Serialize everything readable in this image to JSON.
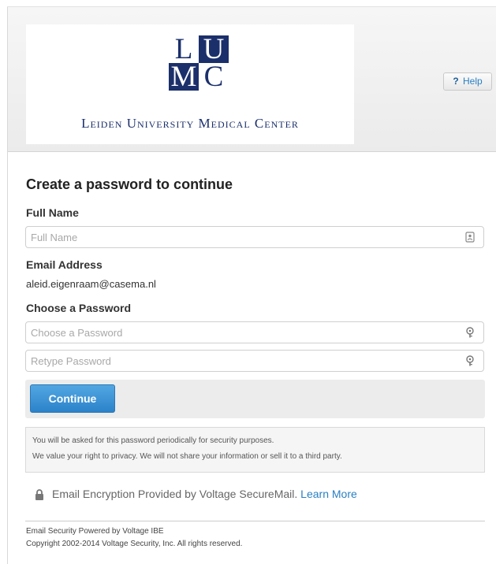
{
  "header": {
    "logo": {
      "letters": [
        "L",
        "U",
        "M",
        "C"
      ],
      "name": "Leiden University Medical Center"
    },
    "help": {
      "icon": "?",
      "label": "Help"
    }
  },
  "form": {
    "title": "Create a password to continue",
    "full_name": {
      "label": "Full Name",
      "placeholder": "Full Name",
      "icon": "contact-card-icon"
    },
    "email": {
      "label": "Email Address",
      "value": "aleid.eigenraam@casema.nl"
    },
    "password": {
      "label": "Choose a Password",
      "placeholder": "Choose a Password",
      "retype_placeholder": "Retype Password",
      "icon": "key-icon"
    },
    "continue_label": "Continue"
  },
  "notice": {
    "line1": "You will be asked for this password periodically for security purposes.",
    "line2": "We value your right to privacy. We will not share your information or sell it to a third party."
  },
  "secure": {
    "text": "Email Encryption Provided by Voltage SecureMail.",
    "link": "Learn More",
    "icon": "lock-icon"
  },
  "footer": {
    "line1": "Email Security Powered by Voltage IBE",
    "line2": "Copyright 2002-2014 Voltage Security, Inc. All rights reserved."
  },
  "colors": {
    "brand_navy": "#1b2f6b",
    "accent_blue": "#2a7fc4",
    "button_blue": "#3b92d6"
  }
}
